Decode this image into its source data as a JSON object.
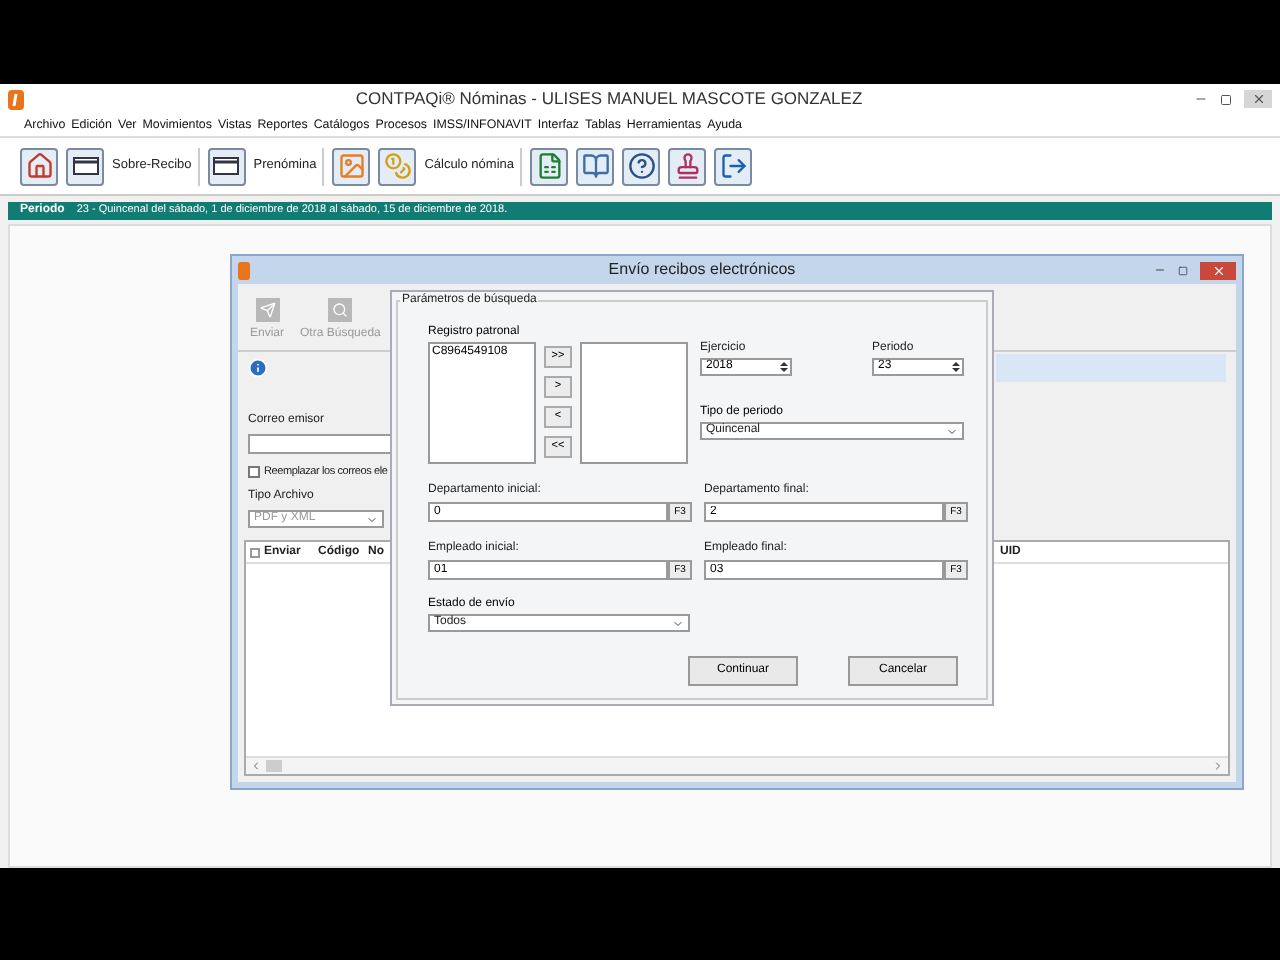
{
  "app_window": {
    "title": "CONTPAQi® Nóminas - ULISES MANUEL MASCOTE GONZALEZ"
  },
  "menu": [
    "Archivo",
    "Edición",
    "Ver",
    "Movimientos",
    "Vistas",
    "Reportes",
    "Catálogos",
    "Procesos",
    "IMSS/INFONAVIT",
    "Interfaz",
    "Tablas",
    "Herramientas",
    "Ayuda"
  ],
  "toolbar": [
    {
      "kind": "icon"
    },
    {
      "kind": "labeled",
      "label": "Sobre-Recibo"
    },
    {
      "kind": "labeled",
      "label": "Prenómina"
    },
    {
      "kind": "icon"
    },
    {
      "kind": "labeled",
      "label": "Cálculo nómina"
    },
    {
      "kind": "icon"
    },
    {
      "kind": "icon"
    },
    {
      "kind": "icon"
    },
    {
      "kind": "icon"
    },
    {
      "kind": "icon"
    }
  ],
  "period_bar": {
    "label": "Periodo",
    "text": "23 - Quincenal del sábado, 1 de diciembre de 2018 al sábado, 15 de diciembre de 2018."
  },
  "child_window": {
    "title": "Envío recibos electrónicos",
    "toolbar": [
      {
        "label": "Enviar",
        "disabled": true
      },
      {
        "label": "Otra Búsqueda",
        "disabled": true
      }
    ],
    "correo_emisor": {
      "label": "Correo emisor"
    },
    "replace_checkbox": {
      "label": "Reemplazar los correos ele",
      "checked": false
    },
    "tipo_archivo": {
      "label": "Tipo Archivo",
      "value": "PDF y XML",
      "disabled": true
    },
    "table": {
      "header_checked": false,
      "columns": [
        "Enviar",
        "Código",
        "No",
        "UID"
      ]
    }
  },
  "dialog": {
    "group_title": "Parámetros de búsqueda",
    "registro_patronal": {
      "label": "Registro patronal",
      "items": [
        "C8964549108"
      ]
    },
    "transfer_buttons": [
      ">>",
      ">",
      "<",
      "<<"
    ],
    "ejercicio": {
      "label": "Ejercicio",
      "value": "2018"
    },
    "periodo": {
      "label": "Periodo",
      "value": "23"
    },
    "tipo_periodo": {
      "label": "Tipo de periodo",
      "value": "Quincenal"
    },
    "departamento_inicial": {
      "label": "Departamento inicial:",
      "value": "0",
      "button": "F3"
    },
    "departamento_final": {
      "label": "Departamento final:",
      "value": "2",
      "button": "F3"
    },
    "empleado_inicial": {
      "label": "Empleado inicial:",
      "value": "01",
      "button": "F3"
    },
    "empleado_final": {
      "label": "Empleado final:",
      "value": "03",
      "button": "F3"
    },
    "estado_envio": {
      "label": "Estado de envío",
      "value": "Todos"
    },
    "buttons": [
      "Continuar",
      "Cancelar"
    ]
  }
}
